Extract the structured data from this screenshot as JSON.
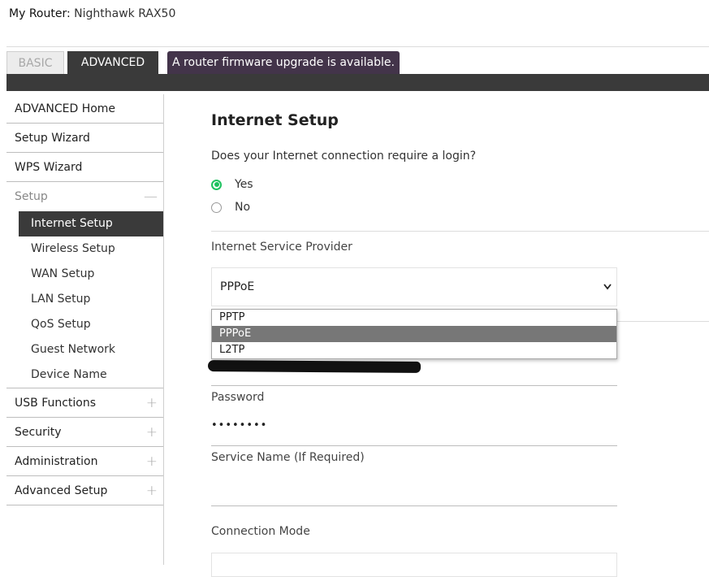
{
  "header": {
    "router_label": "My Router:",
    "router_model": "Nighthawk RAX50"
  },
  "tabs": {
    "basic": "BASIC",
    "advanced": "ADVANCED"
  },
  "banner": {
    "text": "A router firmware upgrade is available."
  },
  "sidebar": {
    "items": [
      {
        "label": "ADVANCED Home"
      },
      {
        "label": "Setup Wizard"
      },
      {
        "label": "WPS Wizard"
      },
      {
        "label": "Setup",
        "sign": "—"
      }
    ],
    "setup_sub": [
      {
        "label": "Internet Setup"
      },
      {
        "label": "Wireless Setup"
      },
      {
        "label": "WAN Setup"
      },
      {
        "label": "LAN Setup"
      },
      {
        "label": "QoS Setup"
      },
      {
        "label": "Guest Network"
      },
      {
        "label": "Device Name"
      }
    ],
    "lower": [
      {
        "label": "USB Functions",
        "sign": "+"
      },
      {
        "label": "Security",
        "sign": "+"
      },
      {
        "label": "Administration",
        "sign": "+"
      },
      {
        "label": "Advanced Setup",
        "sign": "+"
      }
    ]
  },
  "main": {
    "title": "Internet Setup",
    "question": "Does your Internet connection require a login?",
    "radio_yes": "Yes",
    "radio_no": "No",
    "isp_label": "Internet Service Provider",
    "isp_selected": "PPPoE",
    "isp_options": [
      "PPTP",
      "PPPoE",
      "L2TP"
    ],
    "password_label": "Password",
    "password_value": "••••••••",
    "service_name_label": "Service Name (If Required)",
    "connection_mode_label": "Connection Mode"
  },
  "colors": {
    "dark_bar": "#3a3a3a",
    "banner": "#43344a",
    "radio_selected": "#1ec25f",
    "dropdown_highlight": "#777777"
  }
}
